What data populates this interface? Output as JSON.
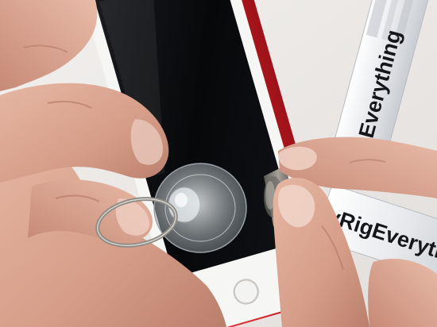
{
  "photo": {
    "subject": "phone-teardown",
    "tool_labels": {
      "upper_strip": "Everything",
      "lower_strip": "vRigEverything"
    }
  },
  "colors": {
    "background": "#ece9e7",
    "phone_frame": "#d8222b",
    "screen": "#0a0b0e",
    "skin": "#d9a48e",
    "skin_shadow": "#b57b68",
    "suction_cup": "#cfd5d8",
    "tool_strip": "#e9ebee",
    "steel": "#7d7a74"
  }
}
